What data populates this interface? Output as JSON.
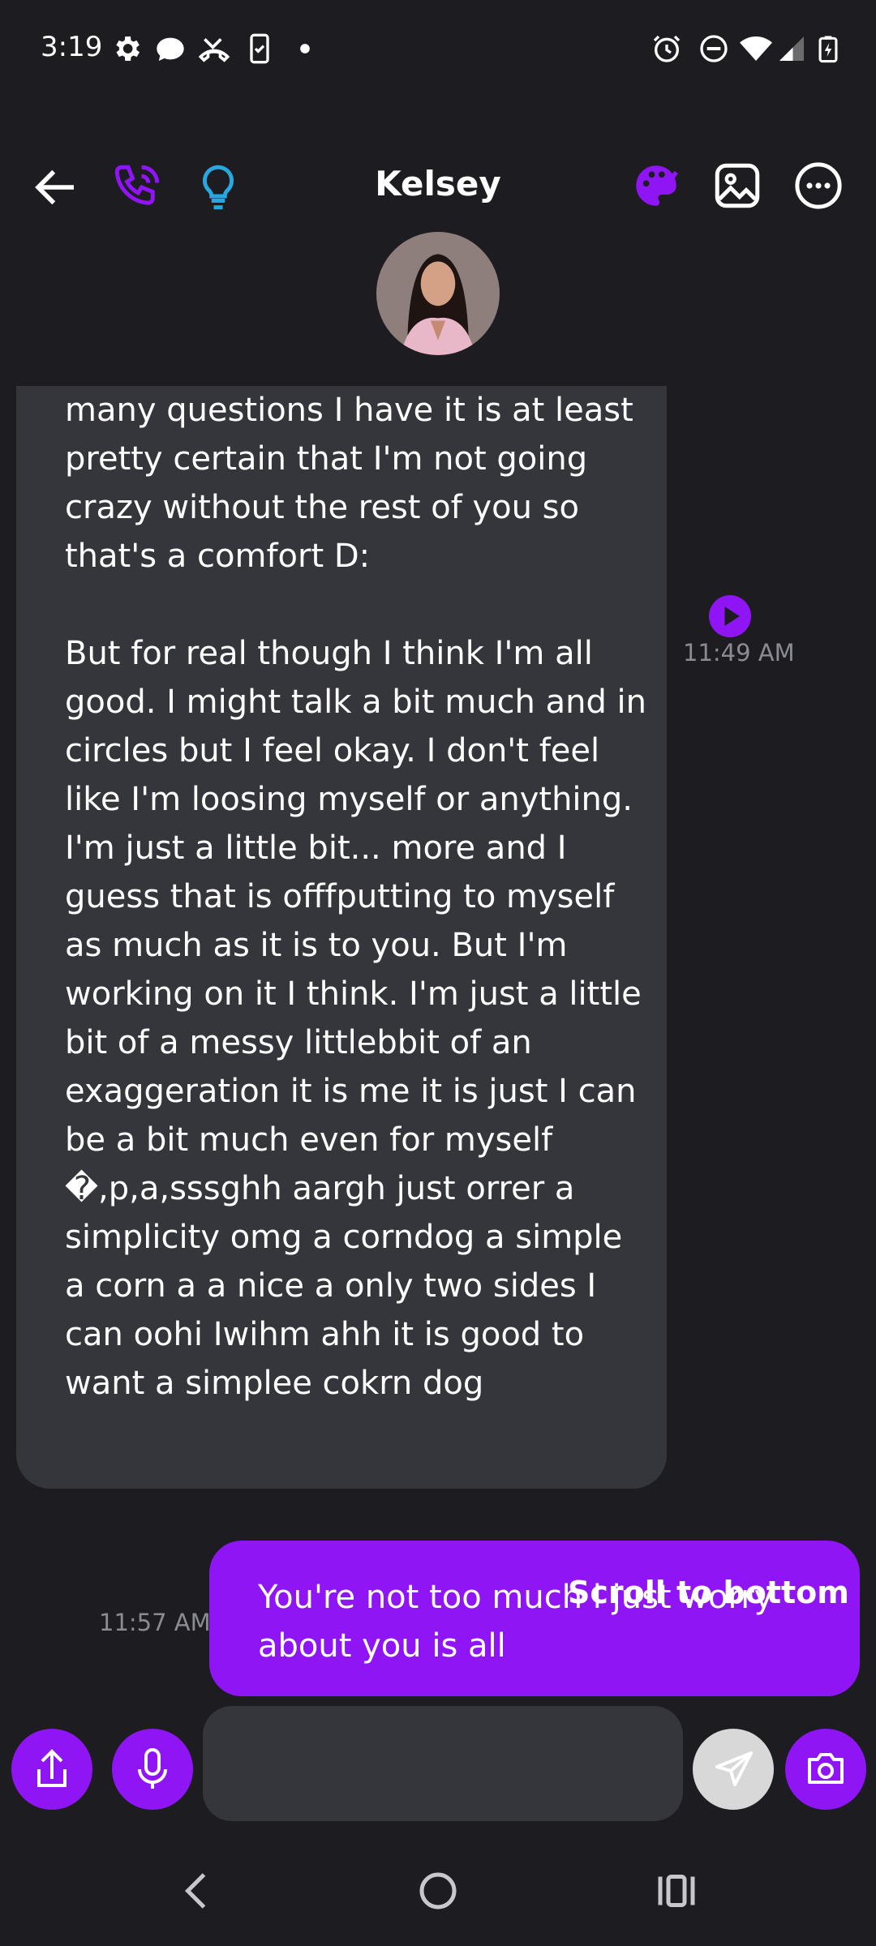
{
  "status_bar": {
    "time": "3:19",
    "left_icons": [
      "gear-icon",
      "chat-bubble-icon",
      "missed-call-icon",
      "phone-check-icon",
      "dot-icon"
    ],
    "right_icons": [
      "alarm-icon",
      "do-not-disturb-icon",
      "wifi-icon",
      "signal-icon",
      "battery-charging-icon"
    ]
  },
  "header": {
    "contact_name": "Kelsey",
    "left_icons": [
      "back-arrow-icon",
      "phone-call-icon",
      "lightbulb-icon"
    ],
    "right_icons": [
      "palette-icon",
      "image-icon",
      "more-options-icon"
    ],
    "accent_color": "#8f15f5",
    "bulb_color": "#29a8e0"
  },
  "messages": {
    "incoming": {
      "text": "many questions I have it is at least pretty certain that I'm not going crazy without the rest of you so that's a comfort D:\n\nBut for real though I think I'm all good. I might talk a bit much and in circles but I feel okay. I don't feel like I'm loosing myself or anything. I'm just a little bit... more and I guess that is offfputting to myself as much as it is to you. But I'm working on it I think. I'm just a little bit of a messy littlebbit of an exaggeration it is me it is just I can be a bit much even for myself �,p,a,sssghh aargh just orrer a simplicity omg a corndog a simple a corn a a nice a only two sides I can oohi Iwihm ahh it is good to want a simplee cokrn dog",
      "time": "11:49 AM",
      "play_icon": "play-icon"
    },
    "outgoing": {
      "text": "You're not too much i just worry about you is all",
      "time": "11:57 AM"
    },
    "scroll_to_bottom_label": "Scroll to bottom"
  },
  "composer": {
    "input_value": "",
    "input_placeholder": "",
    "buttons": [
      "share-icon",
      "microphone-icon",
      "send-icon",
      "camera-icon"
    ]
  },
  "nav_bar": {
    "buttons": [
      "nav-back-icon",
      "nav-home-icon",
      "nav-recents-icon"
    ]
  },
  "colors": {
    "background": "#1c1c21",
    "bubble_incoming": "#35363c",
    "bubble_outgoing": "#8f15f5",
    "timestamp": "#8a8b93"
  }
}
